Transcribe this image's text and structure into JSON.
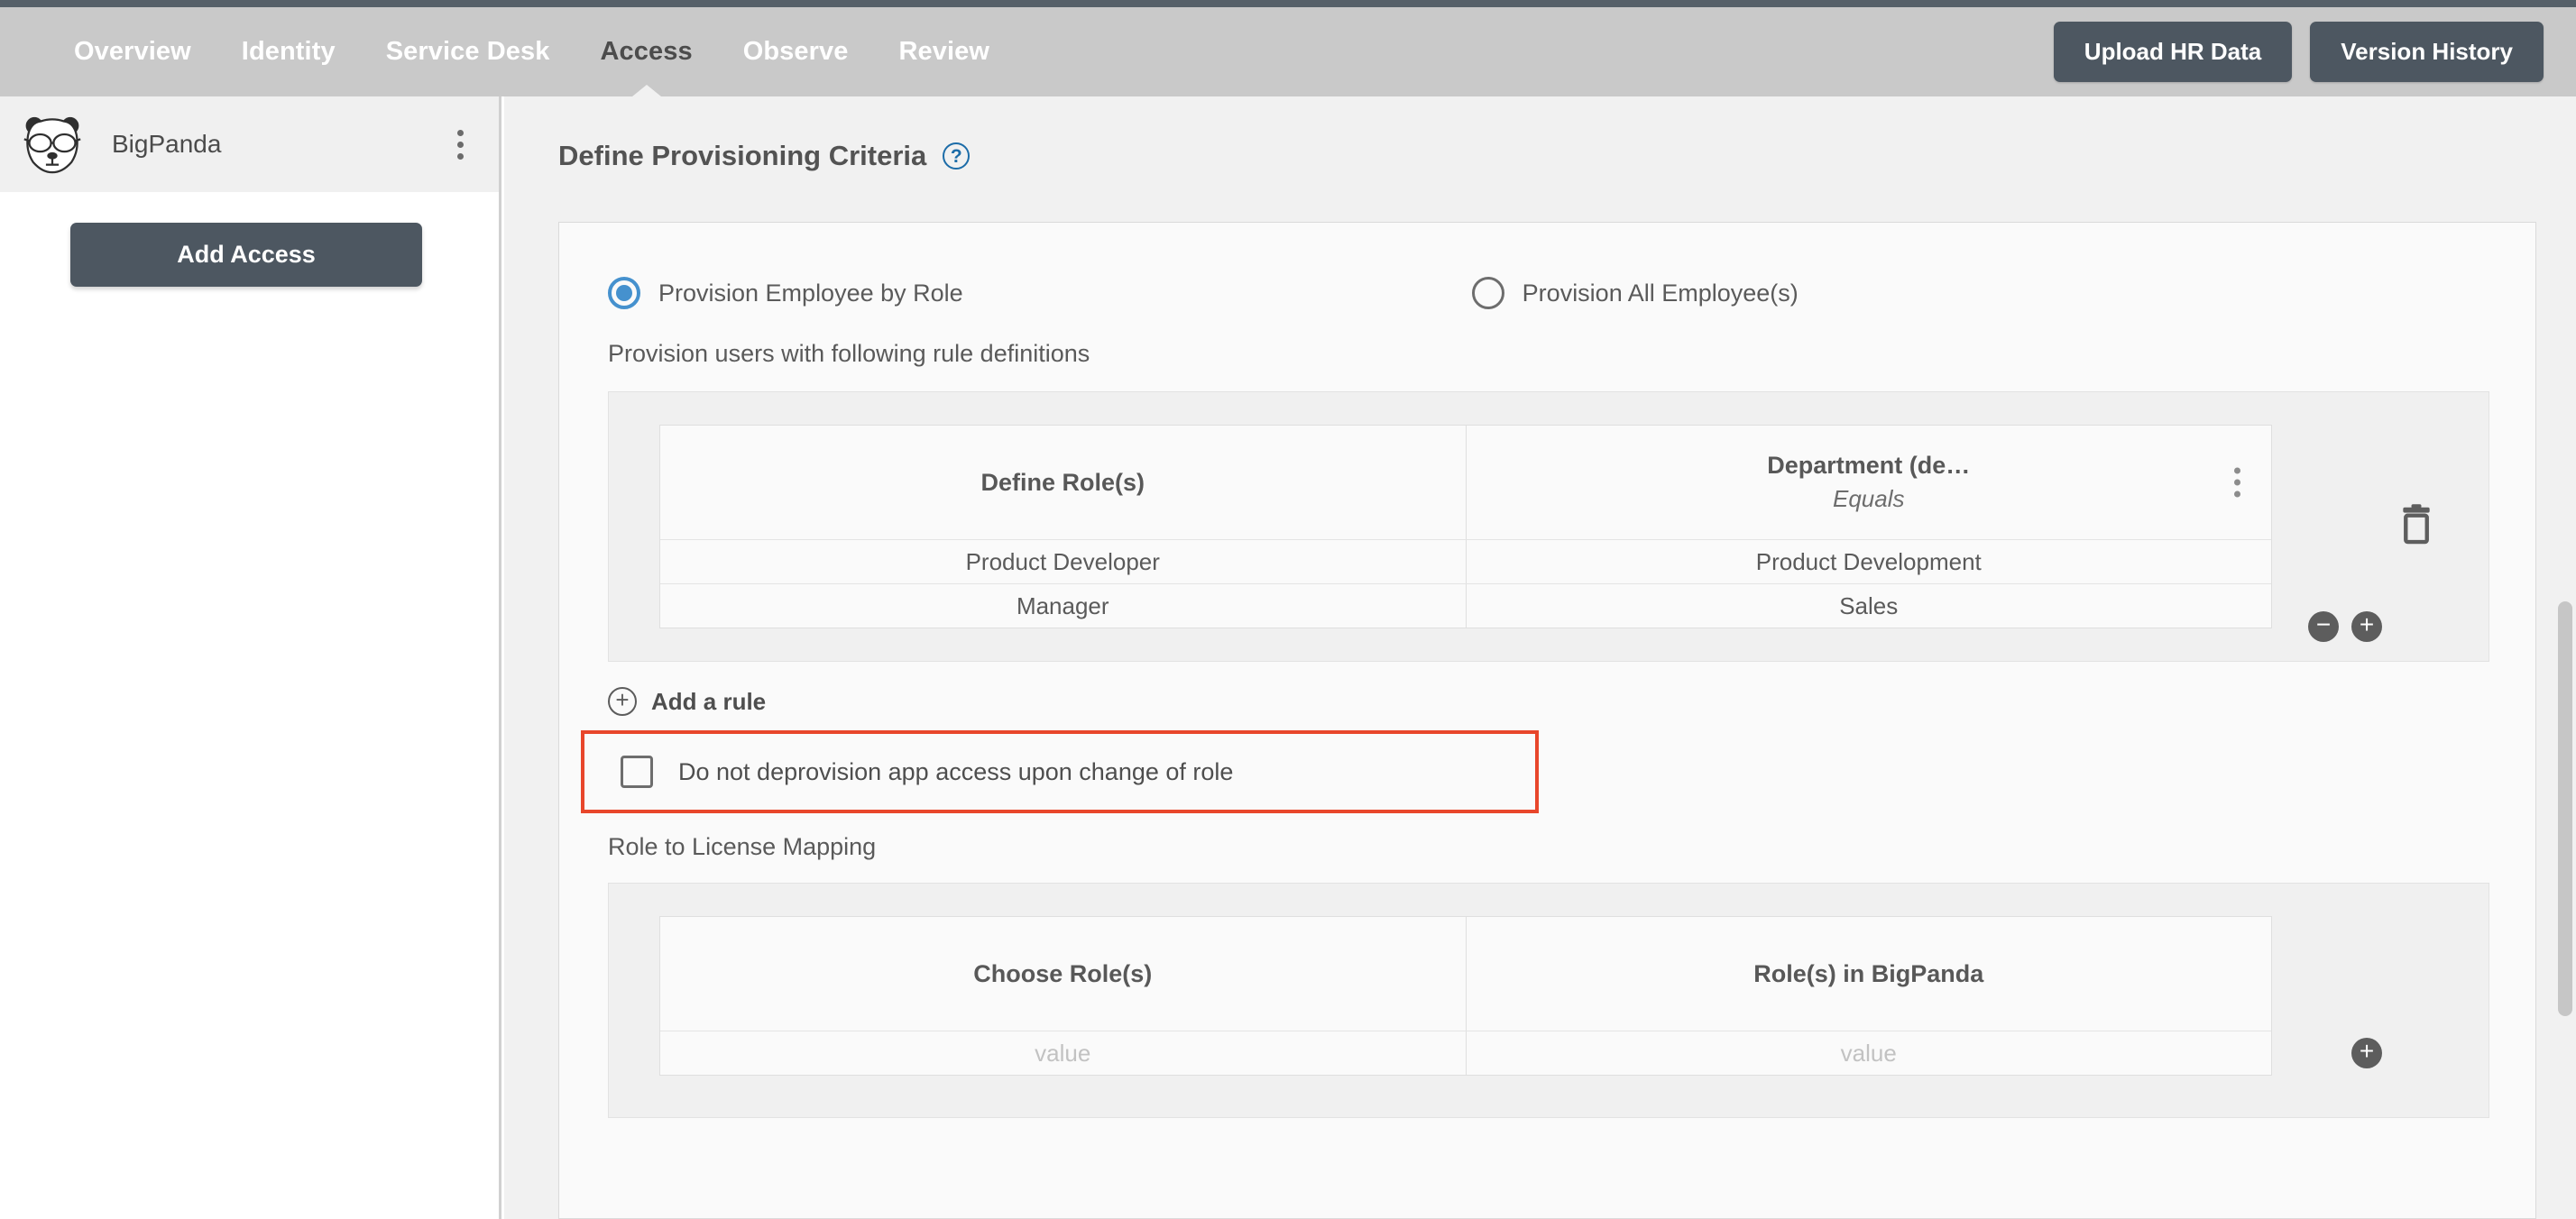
{
  "nav": {
    "tabs": [
      {
        "label": "Overview",
        "active": false
      },
      {
        "label": "Identity",
        "active": false
      },
      {
        "label": "Service Desk",
        "active": false
      },
      {
        "label": "Access",
        "active": true
      },
      {
        "label": "Observe",
        "active": false
      },
      {
        "label": "Review",
        "active": false
      }
    ],
    "upload_label": "Upload HR Data",
    "version_label": "Version History"
  },
  "sidebar": {
    "app_name": "BigPanda",
    "app_icon": "panda-logo",
    "menu_icon": "kebab-menu-icon",
    "add_access_label": "Add Access"
  },
  "main": {
    "section_title": "Define Provisioning Criteria",
    "help_icon": "question-mark-icon",
    "radios": [
      {
        "label": "Provision Employee by Role",
        "selected": true
      },
      {
        "label": "Provision All Employee(s)",
        "selected": false
      }
    ],
    "rule_subtitle": "Provision users with following rule definitions",
    "rule_table": {
      "columns": [
        {
          "title": "Define Role(s)",
          "subtitle": ""
        },
        {
          "title": "Department (de…",
          "subtitle": "Equals"
        }
      ],
      "rows": [
        [
          "Product Developer",
          "Product Development"
        ],
        [
          "Manager",
          "Sales"
        ]
      ],
      "delete_icon": "trash-icon",
      "column_menu_icon": "kebab-menu-icon",
      "remove_row_icon": "minus-circle-icon",
      "add_row_icon": "plus-circle-icon"
    },
    "add_rule_label": "Add a rule",
    "add_rule_icon": "plus-circle-icon",
    "deprovision": {
      "label": "Do not deprovision app access upon change of role",
      "checked": false,
      "highlight_color": "#e8462b"
    },
    "mapping_title": "Role to License Mapping",
    "mapping_table": {
      "columns": [
        {
          "title": "Choose Role(s)",
          "subtitle": ""
        },
        {
          "title": "Role(s) in BigPanda",
          "subtitle": ""
        }
      ],
      "rows": [
        [
          "value",
          "value"
        ]
      ],
      "add_row_icon": "plus-circle-icon"
    }
  },
  "colors": {
    "nav_bg": "#c9c9c9",
    "accent_button": "#4d5761",
    "radio_blue": "#4591ce",
    "help_blue": "#1c6ca8",
    "highlight_red": "#e8462b"
  }
}
